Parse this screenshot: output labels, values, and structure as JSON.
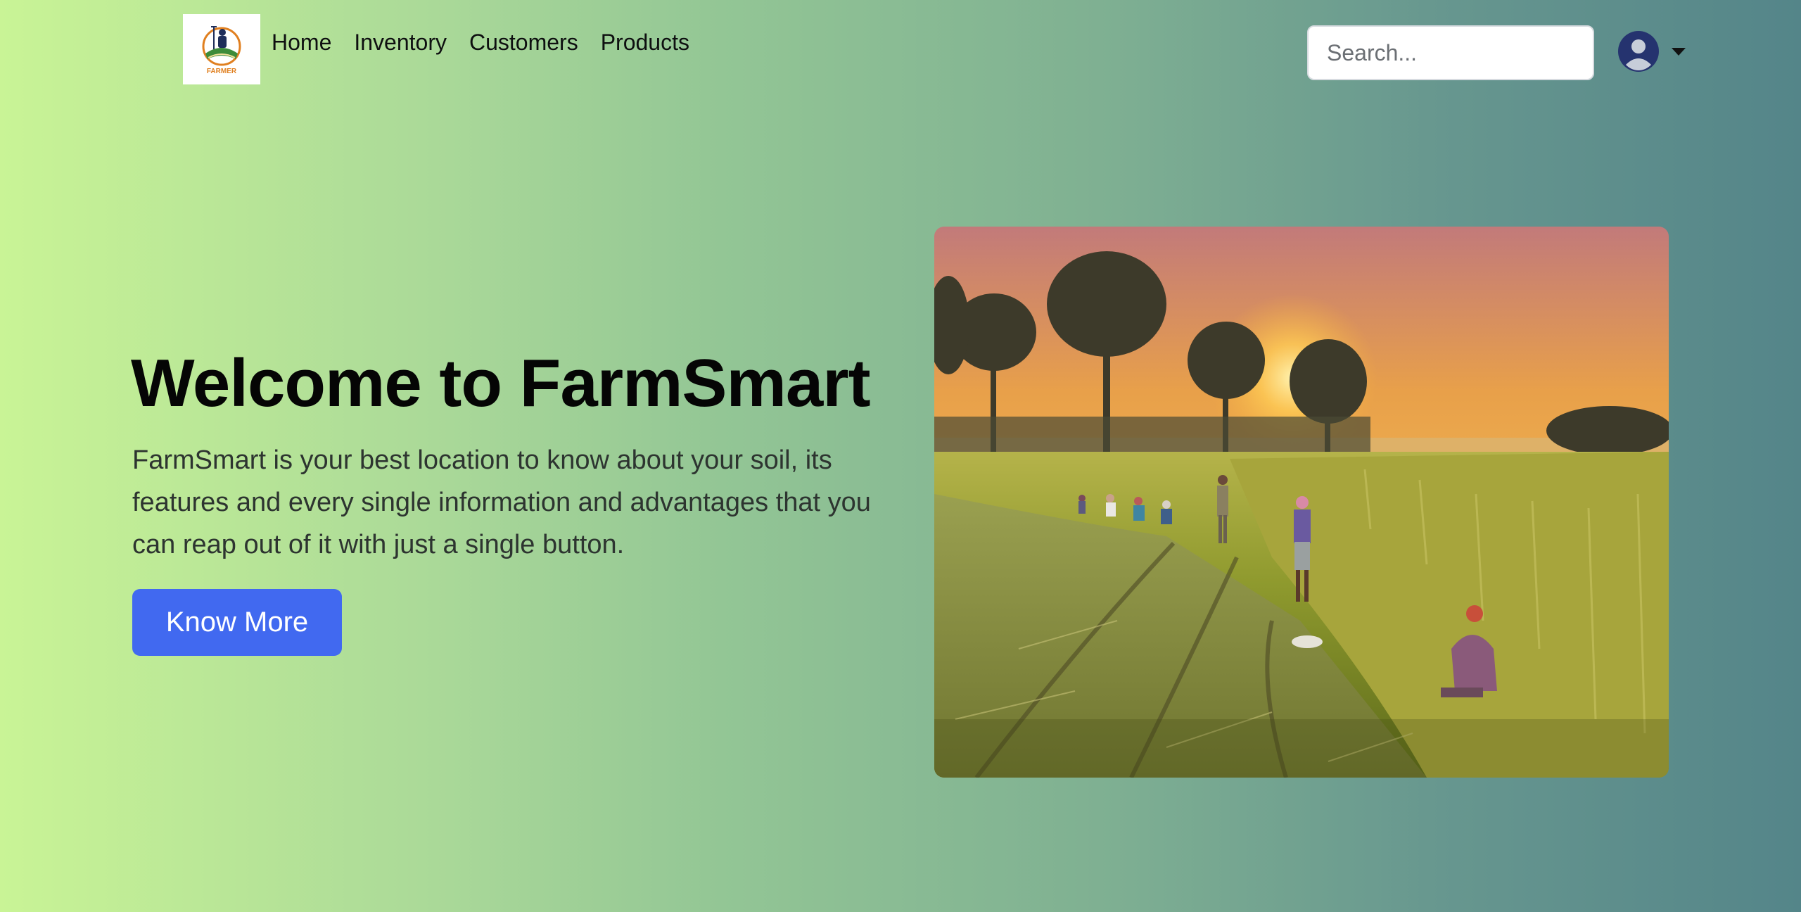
{
  "nav": {
    "logo": {
      "icon": "farmer-logo-icon",
      "text": "FARMER"
    },
    "links": [
      {
        "label": "Home"
      },
      {
        "label": "Inventory"
      },
      {
        "label": "Customers"
      },
      {
        "label": "Products"
      }
    ],
    "search": {
      "placeholder": "Search...",
      "value": ""
    },
    "user": {
      "icon": "user-avatar-icon",
      "menu_icon": "caret-down-icon"
    }
  },
  "hero": {
    "title": "Welcome to FarmSmart",
    "description": "FarmSmart is your best location to know about your soil, its features and every single information and advantages that you can reap out of it with just a single button.",
    "cta_label": "Know More",
    "image": {
      "subject": "farmers-harvesting-rice-field-at-sunset"
    }
  },
  "colors": {
    "gradient_start": "#c9f496",
    "gradient_end": "#548589",
    "cta": "#4169f0",
    "title": "#050505",
    "avatar": "#25336f"
  }
}
